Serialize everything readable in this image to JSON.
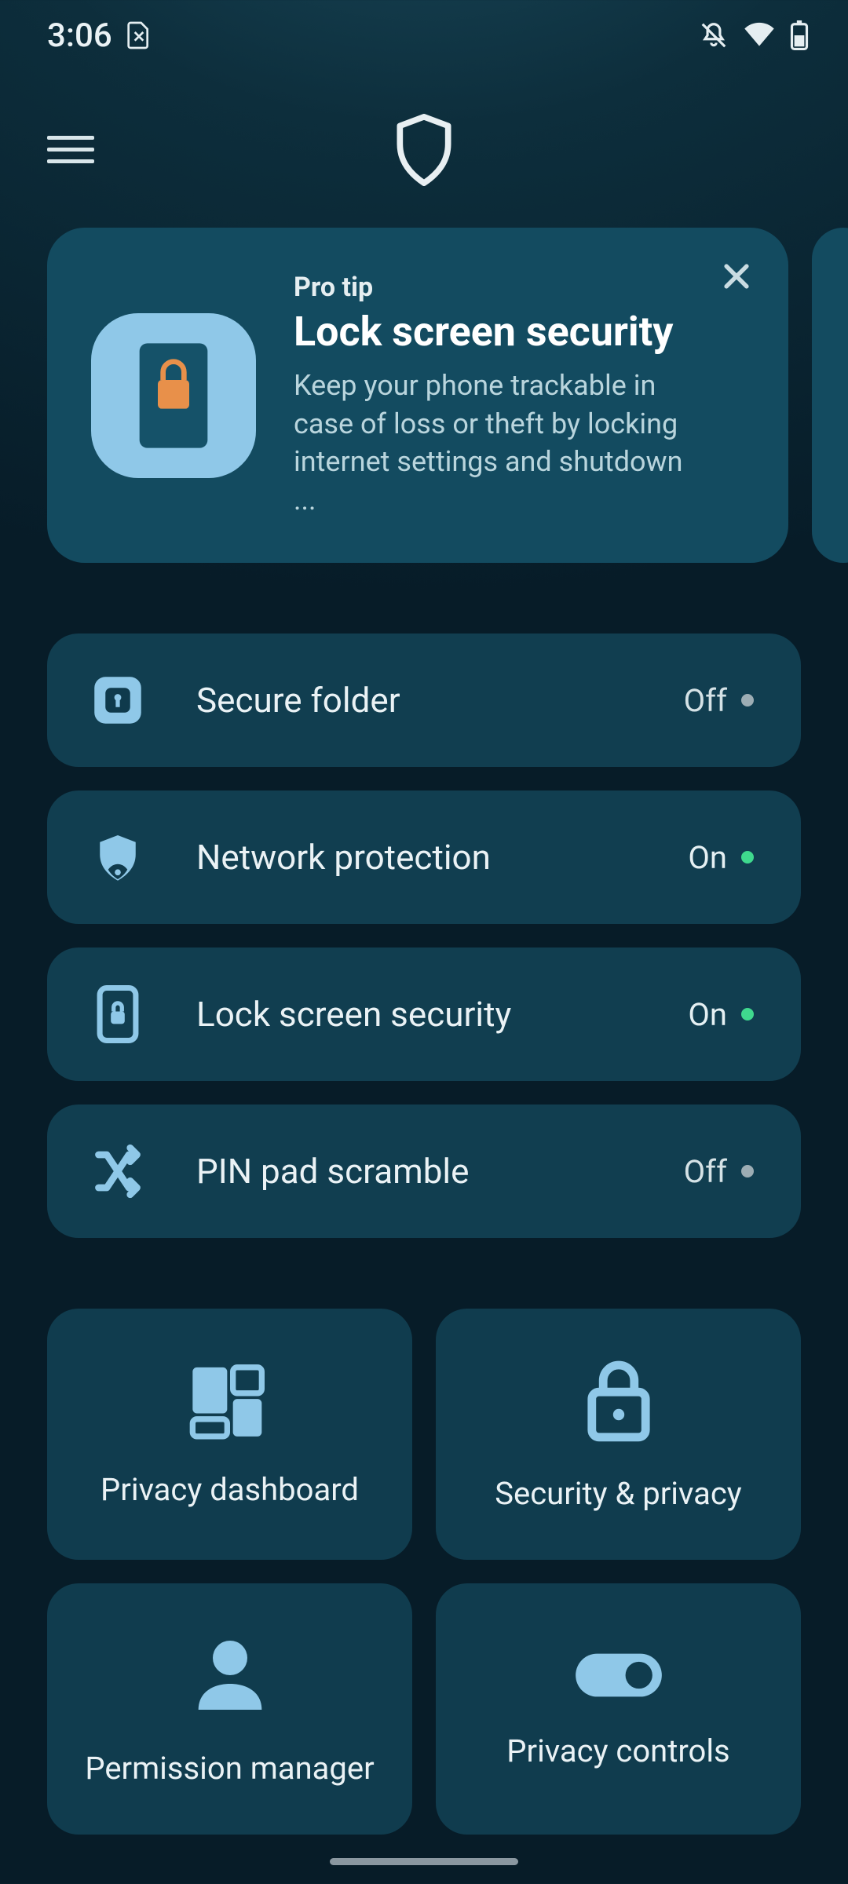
{
  "status": {
    "time": "3:06"
  },
  "tip": {
    "eyebrow": "Pro tip",
    "title": "Lock screen security",
    "body": "Keep your phone trackable in case of loss or theft by locking internet settings and shutdown ..."
  },
  "rows": [
    {
      "label": "Secure folder",
      "status_text": "Off",
      "status": "off"
    },
    {
      "label": "Network protection",
      "status_text": "On",
      "status": "on"
    },
    {
      "label": "Lock screen security",
      "status_text": "On",
      "status": "on"
    },
    {
      "label": "PIN pad scramble",
      "status_text": "Off",
      "status": "off"
    }
  ],
  "tiles": [
    {
      "label": "Privacy dashboard"
    },
    {
      "label": "Security & privacy"
    },
    {
      "label": "Permission manager"
    },
    {
      "label": "Privacy controls"
    }
  ],
  "colors": {
    "accent_light_blue": "#8fc8e8",
    "accent_orange": "#e8904a",
    "dot_on": "#3fd98e",
    "dot_off": "#9dadb4"
  }
}
